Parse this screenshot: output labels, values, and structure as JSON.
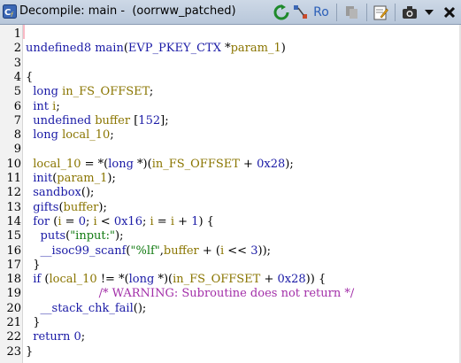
{
  "window": {
    "title": "Decompile: main -  (oorrww_patched)",
    "icons": [
      "decompiler-icon",
      "refresh-icon",
      "find-references-icon",
      "read-only-toggle-icon",
      "copy-icon",
      "edit-icon",
      "snapshot-icon",
      "menu-dropdown-icon",
      "close-icon"
    ],
    "read_only_label": "Ro"
  },
  "gutter": {
    "line_numbers": [
      "1",
      "2",
      "3",
      "4",
      "5",
      "6",
      "7",
      "8",
      "9",
      "10",
      "11",
      "12",
      "13",
      "14",
      "15",
      "16",
      "17",
      "18",
      "19",
      "20",
      "21",
      "22",
      "23"
    ]
  },
  "code": {
    "lines": [
      [],
      [
        [
          "kw",
          "undefined8"
        ],
        [
          "pl",
          " "
        ],
        [
          "fn",
          "main"
        ],
        [
          "pl",
          "("
        ],
        [
          "kw",
          "EVP_PKEY_CTX"
        ],
        [
          "pl",
          " *"
        ],
        [
          "var",
          "param_1"
        ],
        [
          "pl",
          ")"
        ]
      ],
      [],
      [
        [
          "pl",
          "{"
        ]
      ],
      [
        [
          "pl",
          "  "
        ],
        [
          "kw",
          "long"
        ],
        [
          "pl",
          " "
        ],
        [
          "var",
          "in_FS_OFFSET"
        ],
        [
          "pl",
          ";"
        ]
      ],
      [
        [
          "pl",
          "  "
        ],
        [
          "kw",
          "int"
        ],
        [
          "pl",
          " "
        ],
        [
          "var",
          "i"
        ],
        [
          "pl",
          ";"
        ]
      ],
      [
        [
          "pl",
          "  "
        ],
        [
          "kw",
          "undefined"
        ],
        [
          "pl",
          " "
        ],
        [
          "var",
          "buffer"
        ],
        [
          "pl",
          " ["
        ],
        [
          "num",
          "152"
        ],
        [
          "pl",
          "];"
        ]
      ],
      [
        [
          "pl",
          "  "
        ],
        [
          "kw",
          "long"
        ],
        [
          "pl",
          " "
        ],
        [
          "var",
          "local_10"
        ],
        [
          "pl",
          ";"
        ]
      ],
      [],
      [
        [
          "pl",
          "  "
        ],
        [
          "var",
          "local_10"
        ],
        [
          "pl",
          " = *("
        ],
        [
          "kw",
          "long"
        ],
        [
          "pl",
          " *)("
        ],
        [
          "var",
          "in_FS_OFFSET"
        ],
        [
          "pl",
          " + "
        ],
        [
          "num",
          "0x28"
        ],
        [
          "pl",
          ");"
        ]
      ],
      [
        [
          "pl",
          "  "
        ],
        [
          "fn",
          "init"
        ],
        [
          "pl",
          "("
        ],
        [
          "var",
          "param_1"
        ],
        [
          "pl",
          ");"
        ]
      ],
      [
        [
          "pl",
          "  "
        ],
        [
          "fn",
          "sandbox"
        ],
        [
          "pl",
          "();"
        ]
      ],
      [
        [
          "pl",
          "  "
        ],
        [
          "fn",
          "gifts"
        ],
        [
          "pl",
          "("
        ],
        [
          "var",
          "buffer"
        ],
        [
          "pl",
          ");"
        ]
      ],
      [
        [
          "pl",
          "  "
        ],
        [
          "kw",
          "for"
        ],
        [
          "pl",
          " ("
        ],
        [
          "var",
          "i"
        ],
        [
          "pl",
          " = "
        ],
        [
          "num",
          "0"
        ],
        [
          "pl",
          "; "
        ],
        [
          "var",
          "i"
        ],
        [
          "pl",
          " < "
        ],
        [
          "num",
          "0x16"
        ],
        [
          "pl",
          "; "
        ],
        [
          "var",
          "i"
        ],
        [
          "pl",
          " = "
        ],
        [
          "var",
          "i"
        ],
        [
          "pl",
          " + "
        ],
        [
          "num",
          "1"
        ],
        [
          "pl",
          ") {"
        ]
      ],
      [
        [
          "pl",
          "    "
        ],
        [
          "fn",
          "puts"
        ],
        [
          "pl",
          "("
        ],
        [
          "str",
          "\"input:\""
        ],
        [
          "pl",
          ");"
        ]
      ],
      [
        [
          "pl",
          "    "
        ],
        [
          "fn",
          "__isoc99_scanf"
        ],
        [
          "pl",
          "("
        ],
        [
          "str",
          "\"%lf\""
        ],
        [
          "pl",
          ","
        ],
        [
          "var",
          "buffer"
        ],
        [
          "pl",
          " + ("
        ],
        [
          "var",
          "i"
        ],
        [
          "pl",
          " << "
        ],
        [
          "num",
          "3"
        ],
        [
          "pl",
          "));"
        ]
      ],
      [
        [
          "pl",
          "  }"
        ]
      ],
      [
        [
          "pl",
          "  "
        ],
        [
          "kw",
          "if"
        ],
        [
          "pl",
          " ("
        ],
        [
          "var",
          "local_10"
        ],
        [
          "pl",
          " != *("
        ],
        [
          "kw",
          "long"
        ],
        [
          "pl",
          " *)("
        ],
        [
          "var",
          "in_FS_OFFSET"
        ],
        [
          "pl",
          " + "
        ],
        [
          "num",
          "0x28"
        ],
        [
          "pl",
          ")) {"
        ]
      ],
      [
        [
          "pl",
          "                    "
        ],
        [
          "cmt",
          "/* WARNING: Subroutine does not return */"
        ]
      ],
      [
        [
          "pl",
          "    "
        ],
        [
          "fn",
          "__stack_chk_fail"
        ],
        [
          "pl",
          "();"
        ]
      ],
      [
        [
          "pl",
          "  }"
        ]
      ],
      [
        [
          "pl",
          "  "
        ],
        [
          "kw",
          "return"
        ],
        [
          "pl",
          " "
        ],
        [
          "num",
          "0"
        ],
        [
          "pl",
          ";"
        ]
      ],
      [
        [
          "pl",
          "}"
        ]
      ]
    ]
  }
}
